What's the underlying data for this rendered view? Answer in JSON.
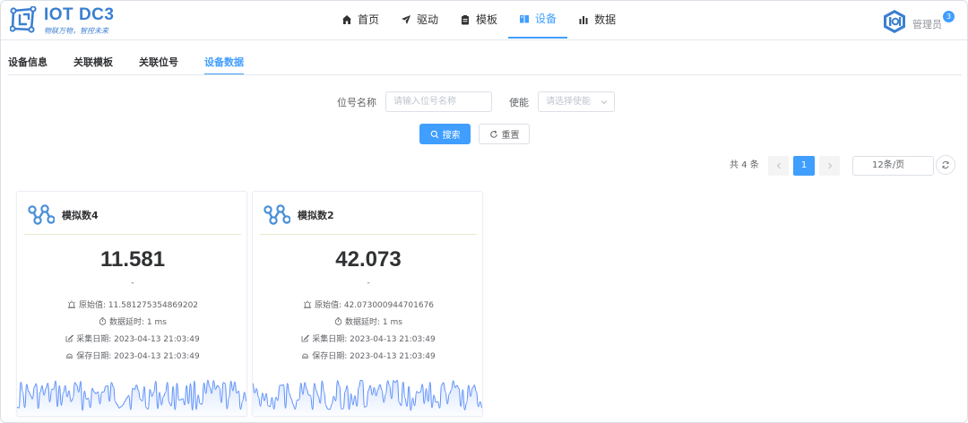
{
  "app": {
    "name": "IOT DC3",
    "slogan": "物联万物，智控未来"
  },
  "nav": [
    {
      "label": "首页",
      "icon": "home-icon",
      "active": false
    },
    {
      "label": "驱动",
      "icon": "paper-plane-icon",
      "active": false
    },
    {
      "label": "模板",
      "icon": "clipboard-icon",
      "active": false
    },
    {
      "label": "设备",
      "icon": "device-icon",
      "active": true
    },
    {
      "label": "数据",
      "icon": "bar-chart-icon",
      "active": false
    }
  ],
  "user": {
    "name": "管理员",
    "badge": "3"
  },
  "tabs": [
    {
      "label": "设备信息",
      "active": false
    },
    {
      "label": "关联模板",
      "active": false
    },
    {
      "label": "关联位号",
      "active": false
    },
    {
      "label": "设备数据",
      "active": true
    }
  ],
  "search": {
    "point_label": "位号名称",
    "point_placeholder": "请输入位号名称",
    "enable_label": "使能",
    "enable_placeholder": "请选择使能",
    "search_button": "搜索",
    "reset_button": "重置"
  },
  "pagination": {
    "total_text": "共 4 条",
    "current_page": "1",
    "page_size": "12条/页"
  },
  "cards": [
    {
      "title": "模拟数4",
      "value": "11.581",
      "unit": "-",
      "raw_label": "原始值: 11.581275354869202",
      "delay_label": "数据延时: 1 ms",
      "collect_label": "采集日期: 2023-04-13 21:03:49",
      "save_label": "保存日期: 2023-04-13 21:03:49"
    },
    {
      "title": "模拟数2",
      "value": "42.073",
      "unit": "-",
      "raw_label": "原始值: 42.073000944701676",
      "delay_label": "数据延时: 1 ms",
      "collect_label": "采集日期: 2023-04-13 21:03:49",
      "save_label": "保存日期: 2023-04-13 21:03:49"
    }
  ],
  "colors": {
    "primary": "#409eff",
    "brand": "#3b7fd0",
    "text": "#303133",
    "wave": "#5b8ff9"
  }
}
